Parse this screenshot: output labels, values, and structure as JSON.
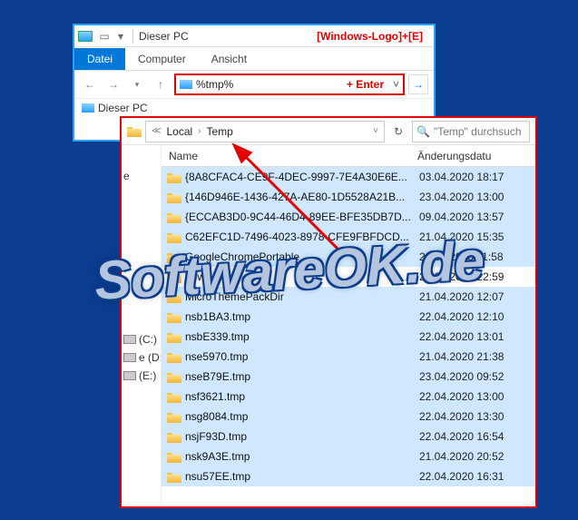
{
  "win1": {
    "title": "Dieser PC",
    "shortcut_hint": "[Windows-Logo]+[E]",
    "tabs": {
      "datei": "Datei",
      "computer": "Computer",
      "ansicht": "Ansicht"
    },
    "address_text": "%tmp%",
    "enter_hint": "+ Enter",
    "crumb": "Dieser PC"
  },
  "win2": {
    "breadcrumb": {
      "part1": "Local",
      "part2": "Temp"
    },
    "search_placeholder": "\"Temp\" durchsuch",
    "columns": {
      "name": "Name",
      "date": "Änderungsdatu"
    },
    "sidebar": {
      "item_e": "e",
      "drive_c": "(C:)",
      "drive_d": "e (D:)",
      "drive_e": "(E:)"
    },
    "files": [
      {
        "name": "{8A8CFAC4-CE9F-4DEC-9997-7E4A30E6E...",
        "date": "03.04.2020 18:17",
        "sel": true
      },
      {
        "name": "{146D946E-1436-427A-AE80-1D5528A21B...",
        "date": "23.04.2020 13:00",
        "sel": true
      },
      {
        "name": "{ECCAB3D0-9C44-46D4-89EE-BFE35DB7D...",
        "date": "09.04.2020 13:57",
        "sel": true
      },
      {
        "name": "C62EFC1D-7496-4023-8978-CFE9FBFDCD...",
        "date": "21.04.2020 15:35",
        "sel": true
      },
      {
        "name": "GoogleChromePortable",
        "date": "23.04.2020 11:58",
        "sel": true
      },
      {
        "name": "Low",
        "date": "21.04.2020 22:59",
        "sel": false
      },
      {
        "name": "MicroThemePackDir",
        "date": "21.04.2020 12:07",
        "sel": true
      },
      {
        "name": "nsb1BA3.tmp",
        "date": "22.04.2020 12:10",
        "sel": true
      },
      {
        "name": "nsbE339.tmp",
        "date": "22.04.2020 13:01",
        "sel": true
      },
      {
        "name": "nse5970.tmp",
        "date": "21.04.2020 21:38",
        "sel": true
      },
      {
        "name": "nseB79E.tmp",
        "date": "23.04.2020 09:52",
        "sel": true
      },
      {
        "name": "nsf3621.tmp",
        "date": "22.04.2020 13:00",
        "sel": true
      },
      {
        "name": "nsg8084.tmp",
        "date": "22.04.2020 13:30",
        "sel": true
      },
      {
        "name": "nsjF93D.tmp",
        "date": "22.04.2020 16:54",
        "sel": true
      },
      {
        "name": "nsk9A3E.tmp",
        "date": "21.04.2020 20:52",
        "sel": true
      },
      {
        "name": "nsu57EE.tmp",
        "date": "22.04.2020 16:31",
        "sel": true
      }
    ]
  },
  "watermark": "SoftwareOK.de"
}
